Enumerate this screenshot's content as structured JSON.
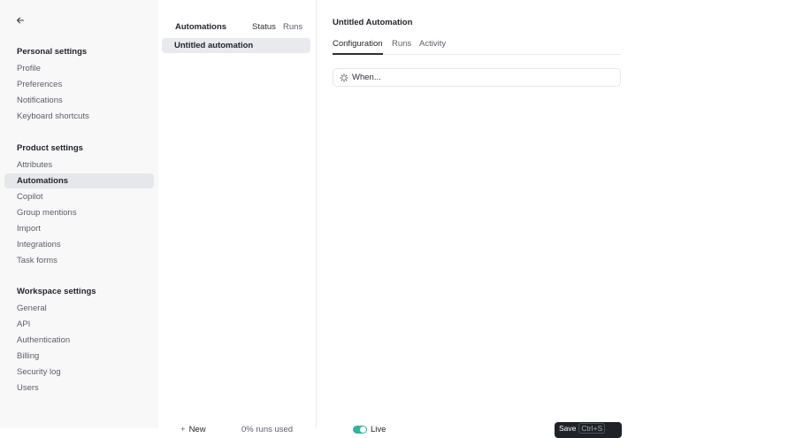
{
  "sidebar": {
    "personal_title": "Personal settings",
    "personal_items": [
      "Profile",
      "Preferences",
      "Notifications",
      "Keyboard shortcuts"
    ],
    "product_title": "Product settings",
    "product_items": [
      "Attributes",
      "Automations",
      "Copilot",
      "Group mentions",
      "Import",
      "Integrations",
      "Task forms"
    ],
    "workspace_title": "Workspace settings",
    "workspace_items": [
      "General",
      "API",
      "Authentication",
      "Billing",
      "Security log",
      "Users"
    ],
    "active_item": "Automations"
  },
  "automations_list": {
    "header_title": "Automations",
    "col_status": "Status",
    "col_runs": "Runs",
    "rows": [
      "Untitled automation"
    ],
    "new_label": "New",
    "runs_used": "0% runs used"
  },
  "detail": {
    "title": "Untitled Automation",
    "tabs": [
      "Configuration",
      "Runs",
      "Activity"
    ],
    "active_tab": "Configuration",
    "trigger_placeholder": "When...",
    "live_label": "Live",
    "live_on": true,
    "save_label": "Save",
    "save_shortcut": "Ctrl+S"
  },
  "colors": {
    "toggle_on": "#35b2a0",
    "save_bg": "#1f2328",
    "active_bg": "#e6e7ea"
  }
}
